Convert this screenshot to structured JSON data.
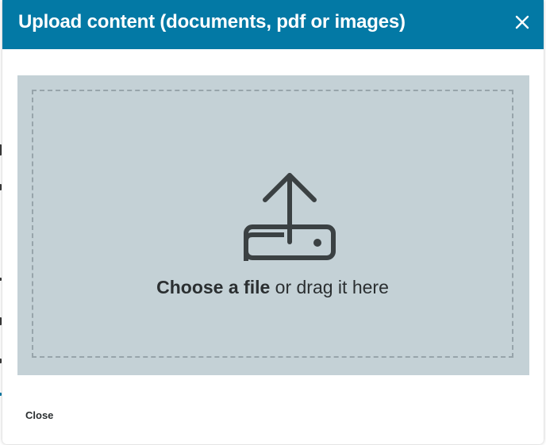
{
  "dialog": {
    "title": "Upload content (documents, pdf or images)",
    "close_icon": "close-icon",
    "header_color": "#0379a5"
  },
  "dropzone": {
    "icon": "upload-icon",
    "choose_label": "Choose a file",
    "drag_label": " or drag it here",
    "background_color": "#c4d1d6"
  },
  "footer": {
    "close_label": "Close"
  }
}
